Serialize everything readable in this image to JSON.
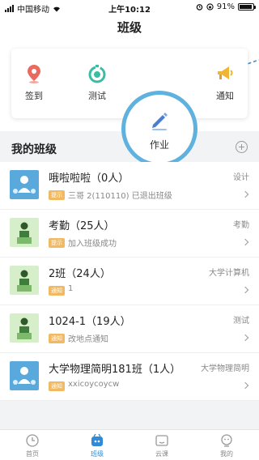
{
  "status_bar": {
    "carrier": "中国移动",
    "time": "上午10:12",
    "battery": "91%",
    "battery_level": 0.91
  },
  "nav": {
    "title": "班级"
  },
  "quick_actions": {
    "items": [
      {
        "label": "签到",
        "icon": "location-pin-icon",
        "color": "#e86b5f"
      },
      {
        "label": "测试",
        "icon": "stopwatch-icon",
        "color": "#3bbca5"
      },
      {
        "label": "作业",
        "icon": "pencil-icon",
        "color": "#4a7fd0"
      },
      {
        "label": "通知",
        "icon": "megaphone-icon",
        "color": "#f0b532"
      }
    ]
  },
  "my_classes": {
    "title": "我的班级",
    "rows": [
      {
        "name": "哦啦啦啦（0人）",
        "course": "设计",
        "tag": "提示",
        "message": "三哥 2(110110) 已退出班级"
      },
      {
        "name": "考勤（25人）",
        "course": "考勤",
        "tag": "提示",
        "message": "加入班级成功"
      },
      {
        "name": "2班（24人）",
        "course": "大学计算机",
        "tag": "通知",
        "message": "1"
      },
      {
        "name": "1024-1（19人）",
        "course": "测试",
        "tag": "通知",
        "message": "改地点通知"
      },
      {
        "name": "大学物理简明181班（1人）",
        "course": "大学物理简明",
        "tag": "通知",
        "message": "xxicoycoycw"
      }
    ]
  },
  "tab_bar": {
    "tabs": [
      {
        "label": "首页",
        "icon": "home-clock-icon"
      },
      {
        "label": "班级",
        "icon": "class-icon",
        "active": true
      },
      {
        "label": "云课",
        "icon": "cloud-course-icon"
      },
      {
        "label": "我的",
        "icon": "profile-icon"
      }
    ]
  },
  "colors": {
    "accent": "#2f8ad8",
    "highlight_ring": "#5fb1de",
    "tag": "#f0b962"
  }
}
